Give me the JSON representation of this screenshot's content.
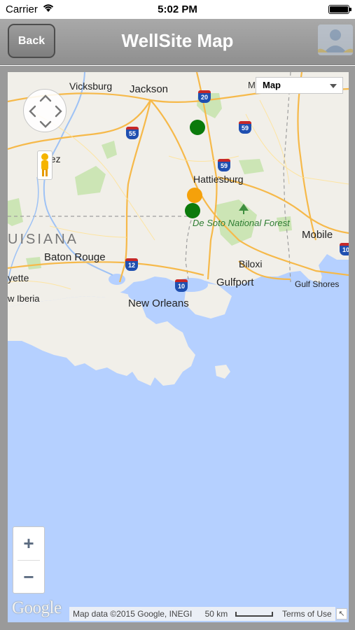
{
  "status_bar": {
    "carrier": "Carrier",
    "time": "5:02 PM"
  },
  "nav": {
    "back_label": "Back",
    "title": "WellSite Map",
    "right_icon": "users-icon"
  },
  "map": {
    "type_label": "Map",
    "type_ghost_label": "M",
    "zoom_in": "+",
    "zoom_out": "−",
    "logo": "Google",
    "attribution": "Map data ©2015 Google, INEGI",
    "scale_label": "50 km",
    "terms": "Terms of Use",
    "labels": {
      "vicksburg": "Vicksburg",
      "jackson": "Jackson",
      "natchez": "chez",
      "hattiesburg": "Hattiesburg",
      "desoto": "De Soto National Forest",
      "louisiana": "UISIANA",
      "mobile": "Mobile",
      "baton_rouge": "Baton Rouge",
      "biloxi": "Biloxi",
      "gulfport": "Gulfport",
      "lafayette": "yette",
      "new_iberia": "w Iberia",
      "new_orleans": "New Orleans",
      "gulf_shores": "Gulf Shores"
    },
    "shields": {
      "i20": "20",
      "i55": "55",
      "i59": "59",
      "i59b": "59",
      "i12": "12",
      "i10": "10",
      "i10b": "10"
    },
    "markers": [
      {
        "status": "green",
        "color": "#0b7a0b"
      },
      {
        "status": "orange",
        "color": "#f5a10a"
      },
      {
        "status": "green",
        "color": "#0b7a0b"
      }
    ]
  }
}
